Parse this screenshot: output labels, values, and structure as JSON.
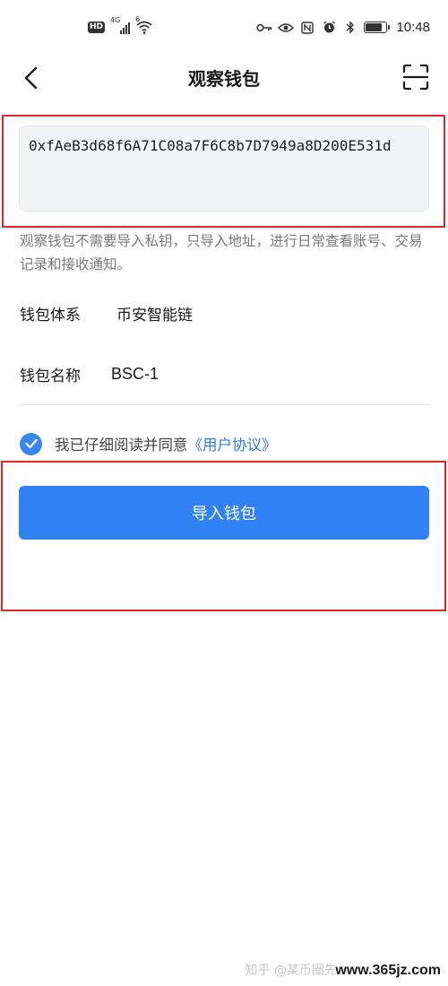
{
  "status_bar": {
    "hd_badge": "HD",
    "network": "4G",
    "wifi_badge": "6",
    "battery_level": 0.85,
    "time": "10:48",
    "icons": [
      "key-icon",
      "eye-icon",
      "nfc-icon",
      "alarm-icon",
      "bluetooth-icon"
    ]
  },
  "header": {
    "title": "观察钱包",
    "back_icon": "chevron-left-icon",
    "scan_icon": "scan-icon"
  },
  "address": {
    "value": "0xfAeB3d68f6A71C08a7F6C8b7D7949a8D200E531d"
  },
  "hint": "观察钱包不需要导入私钥，只导入地址，进行日常查看账号、交易记录和接收通知。",
  "fields": {
    "system_label": "钱包体系",
    "system_value": "币安智能链",
    "name_label": "钱包名称",
    "name_value": "BSC-1"
  },
  "agreement": {
    "checked": true,
    "text": "我已仔细阅读并同意",
    "link": "《用户协议》"
  },
  "import_button": "导入钱包",
  "watermark": {
    "text": "知乎 @某币圈先生",
    "url": "www.365jz.com"
  },
  "colors": {
    "primary": "#3282f6",
    "link": "#2f7de0",
    "highlight": "#e0262d"
  }
}
